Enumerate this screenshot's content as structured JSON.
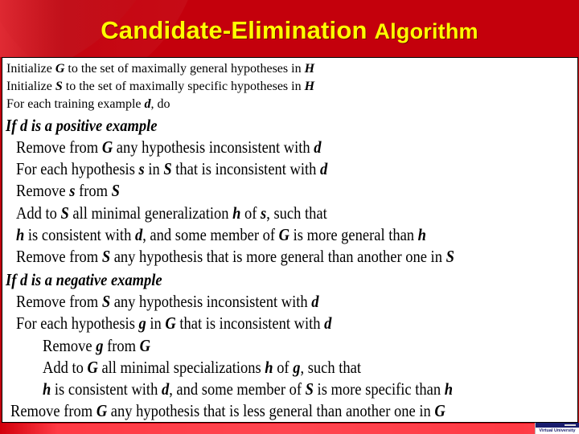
{
  "title": {
    "part1": "Candidate-Elimination",
    "part2": "Algorithm"
  },
  "init_lines": [
    {
      "pre": "Initialize ",
      "var": "G",
      "post": " to the set of maximally general hypotheses in ",
      "var2": "H"
    },
    {
      "pre": "Initialize ",
      "var": "S",
      "post": " to the set of maximally specific hypotheses in ",
      "var2": "H"
    },
    {
      "pre": "For each training example ",
      "var": "d",
      "post": ", do"
    }
  ],
  "positive_case": {
    "heading": "If d is a positive example",
    "lines": [
      [
        "Remove from ",
        "G",
        " any hypothesis inconsistent with ",
        "d"
      ],
      [
        "For each hypothesis ",
        "s",
        " in ",
        "S",
        " that is inconsistent with ",
        "d"
      ],
      [
        "Remove ",
        "s",
        " from ",
        "S"
      ],
      [
        "Add to ",
        "S",
        " all minimal generalization ",
        "h",
        " of ",
        "s",
        ", such that"
      ],
      [
        "",
        "h",
        " is consistent with ",
        "d",
        ", and some member of ",
        "G",
        " is more general than ",
        "h"
      ],
      [
        "Remove from ",
        "S",
        " any hypothesis that is more general than another one in ",
        "S"
      ]
    ]
  },
  "negative_case": {
    "heading": "If d is a negative example",
    "lines": [
      [
        "Remove from ",
        "S",
        " any hypothesis inconsistent with ",
        "d"
      ],
      [
        "For each hypothesis ",
        "g",
        " in ",
        "G",
        " that is inconsistent with ",
        "d"
      ],
      [
        "Remove ",
        "g",
        " from ",
        "G"
      ],
      [
        "Add to ",
        "G",
        " all minimal specializations ",
        "h",
        " of ",
        "g",
        ", such that"
      ],
      [
        "",
        "h",
        " is consistent with ",
        "d",
        ", and some member of ",
        "S",
        " is more specific than ",
        "h"
      ],
      [
        "Remove from ",
        "G",
        " any hypothesis that is less general than another one in ",
        "G"
      ]
    ]
  },
  "logo": {
    "text": "Virtual University"
  },
  "colors": {
    "header_bg": "#c4000c",
    "title_text": "#ffff00",
    "footer_bg": "#ff4650",
    "logo_navy": "#1a1e6e"
  }
}
